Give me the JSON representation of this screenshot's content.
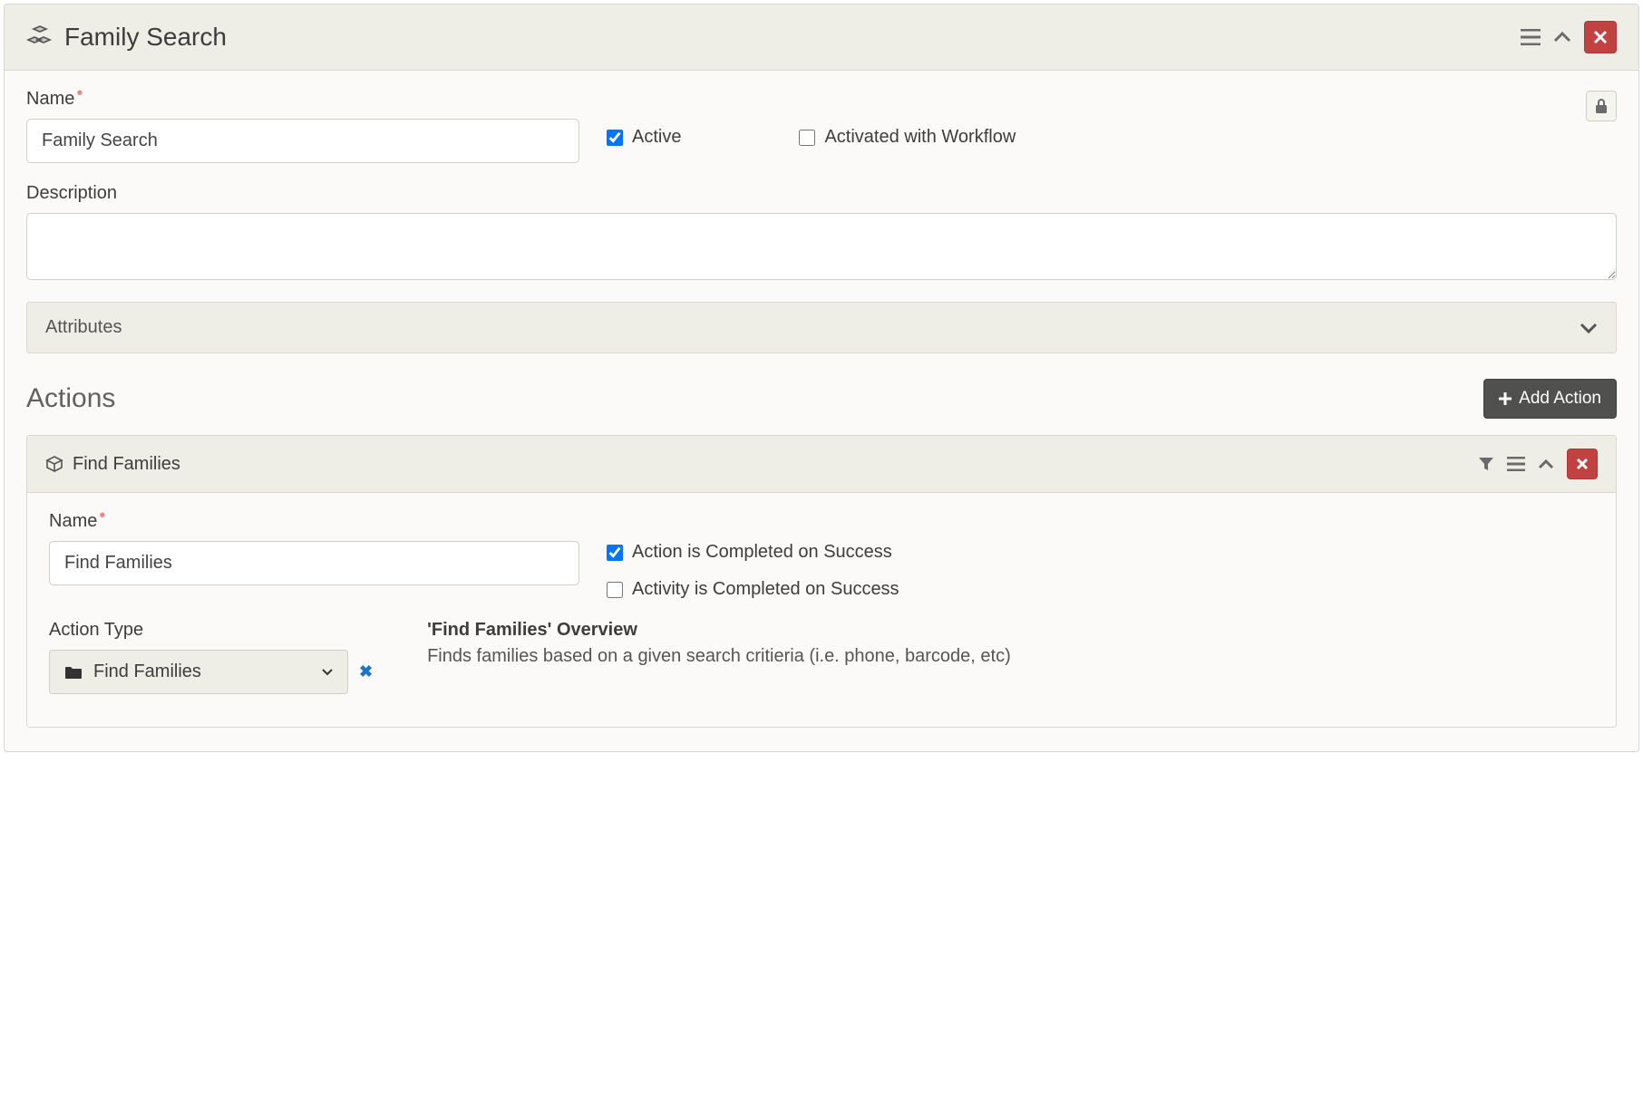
{
  "header": {
    "title": "Family Search"
  },
  "form": {
    "name_label": "Name",
    "name_value": "Family Search",
    "active_label": "Active",
    "active_checked": true,
    "workflow_label": "Activated with Workflow",
    "workflow_checked": false,
    "description_label": "Description",
    "description_value": ""
  },
  "attributes": {
    "label": "Attributes"
  },
  "actions": {
    "heading": "Actions",
    "add_button": "Add Action",
    "items": [
      {
        "title": "Find Families",
        "name_label": "Name",
        "name_value": "Find Families",
        "completed_on_success_label": "Action is Completed on Success",
        "completed_on_success_checked": true,
        "activity_completed_label": "Activity is Completed on Success",
        "activity_completed_checked": false,
        "action_type_label": "Action Type",
        "action_type_value": "Find Families",
        "overview_title": "'Find Families' Overview",
        "overview_text": "Finds families based on a given search critieria (i.e. phone, barcode, etc)"
      }
    ]
  }
}
